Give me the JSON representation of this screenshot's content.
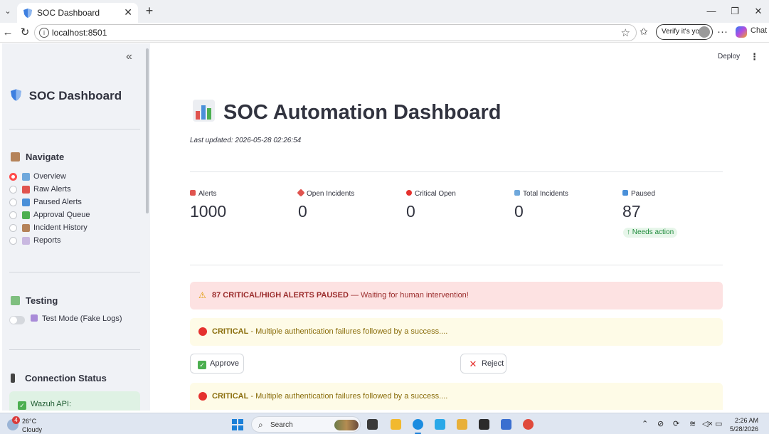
{
  "browser": {
    "tab_title": "SOC Dashboard",
    "tab_close": "✕",
    "new_tab": "+",
    "url": "localhost:8501",
    "verify_label": "Verify it's you",
    "chat_label": "Chat",
    "window_controls": [
      "—",
      "❐",
      "✕"
    ]
  },
  "sidebar": {
    "title": "SOC Dashboard",
    "collapse_glyph": "«",
    "navigate_heading": "Navigate",
    "nav_items": [
      {
        "label": "Overview",
        "selected": true,
        "icon": "bar-chart-icon",
        "color": "#6fa8dc"
      },
      {
        "label": "Raw Alerts",
        "selected": false,
        "icon": "siren-icon",
        "color": "#e0544f"
      },
      {
        "label": "Paused Alerts",
        "selected": false,
        "icon": "pause-icon",
        "color": "#4a90d9"
      },
      {
        "label": "Approval Queue",
        "selected": false,
        "icon": "check-icon",
        "color": "#4caf50"
      },
      {
        "label": "Incident History",
        "selected": false,
        "icon": "ledger-icon",
        "color": "#b5835a"
      },
      {
        "label": "Reports",
        "selected": false,
        "icon": "document-icon",
        "color": "#c9b8e0"
      }
    ],
    "testing_heading": "Testing",
    "test_mode_label": "Test Mode (Fake Logs)",
    "connection_heading": "Connection Status",
    "wazuh_status": "Wazuh API:"
  },
  "header": {
    "deploy_label": "Deploy",
    "menu_glyph": "⋮"
  },
  "main": {
    "title": "SOC Automation Dashboard",
    "last_updated": "Last updated: 2026-05-28 02:26:54",
    "metrics": [
      {
        "label": "Alerts",
        "value": "1000",
        "icon": "siren-icon",
        "color": "#e0544f"
      },
      {
        "label": "Open Incidents",
        "value": "0",
        "icon": "pushpin-icon",
        "color": "#e0544f"
      },
      {
        "label": "Critical Open",
        "value": "0",
        "icon": "red-circle-icon",
        "color": "#e5312e"
      },
      {
        "label": "Total Incidents",
        "value": "0",
        "icon": "bar-chart-icon",
        "color": "#6fa8dc"
      },
      {
        "label": "Paused",
        "value": "87",
        "icon": "pause-icon",
        "color": "#4a90d9"
      }
    ],
    "paused_delta": "↑ Needs action",
    "paused_banner_bold": "87 CRITICAL/HIGH ALERTS PAUSED",
    "paused_banner_rest": " — Waiting for human intervention!",
    "alerts": [
      {
        "severity": "CRITICAL",
        "text": " - Multiple authentication failures followed by a success...."
      },
      {
        "severity": "CRITICAL",
        "text": " - Multiple authentication failures followed by a success...."
      }
    ],
    "approve_label": "Approve",
    "reject_label": "Reject"
  },
  "taskbar": {
    "weather_badge": "4",
    "temperature": "26°C",
    "condition": "Cloudy",
    "search_label": "Search",
    "time": "2:26 AM",
    "date": "5/28/2026"
  }
}
